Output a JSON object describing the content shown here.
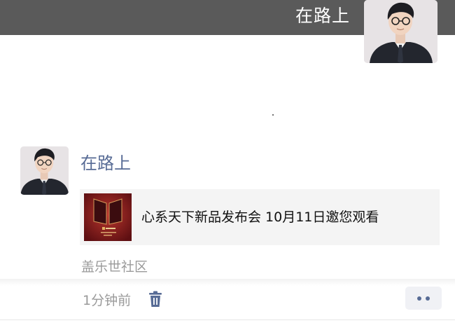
{
  "cover": {
    "user_name": "在路上",
    "avatar_icon": "user-avatar-man-with-glasses"
  },
  "post": {
    "author": "在路上",
    "avatar_icon": "user-avatar-man-with-glasses",
    "link_card": {
      "title": "心系天下新品发布会 10月11日邀您观看",
      "thumbnail_icon": "foldable-phone-launch-poster"
    },
    "source": "盖乐世社区",
    "time": "1分钟前",
    "delete_icon": "trash-icon",
    "more_icon": "two-dots-icon"
  },
  "colors": {
    "author_name": "#576b95",
    "header_bar": "#5a5a5a",
    "meta_text": "#9a9a9a",
    "card_bg": "#f4f4f4"
  }
}
